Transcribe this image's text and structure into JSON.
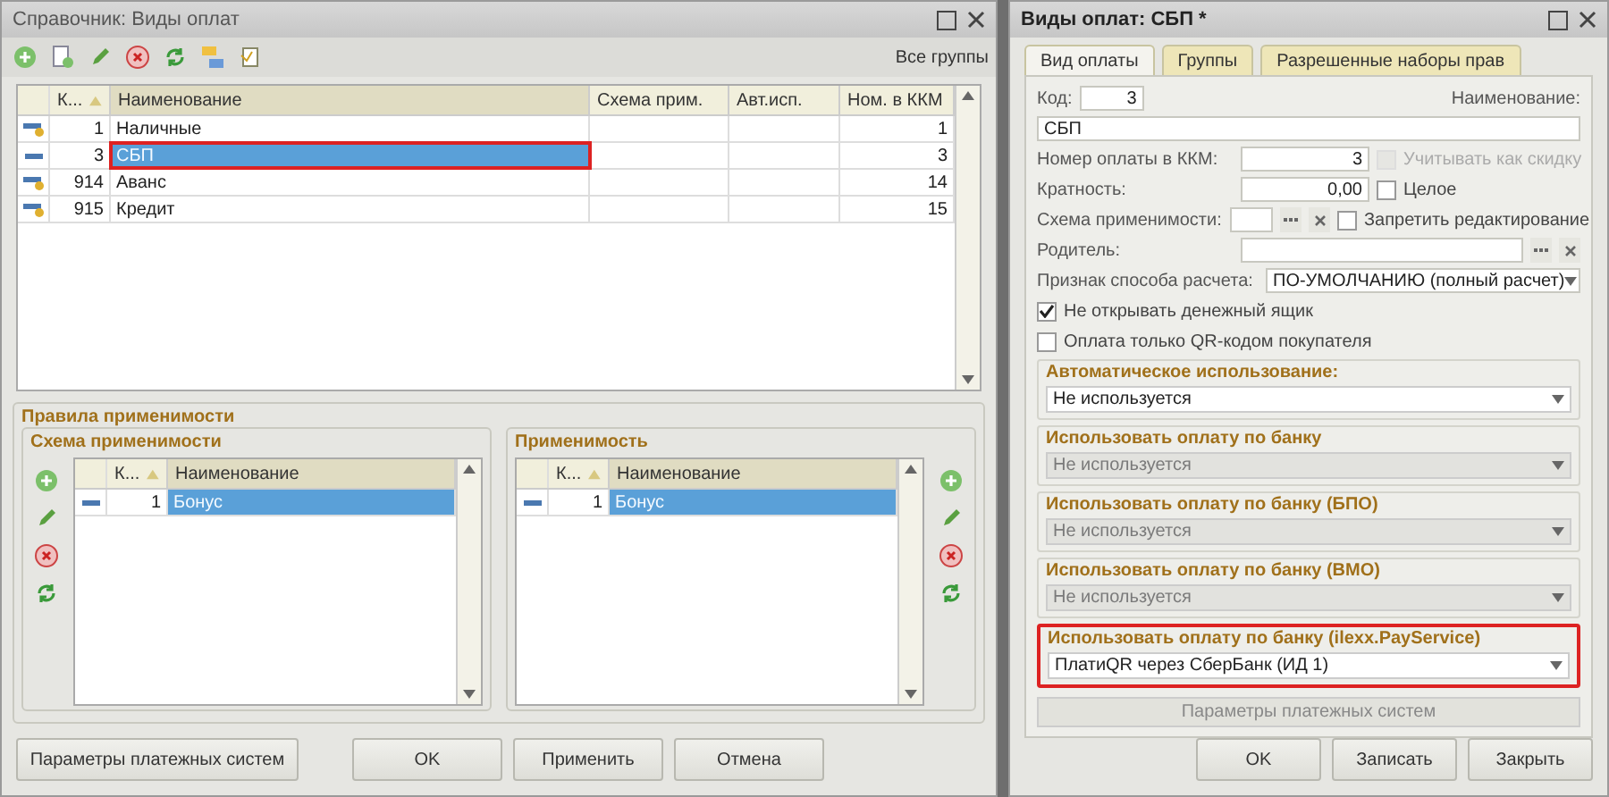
{
  "list_window": {
    "title": "Справочник: Виды оплат",
    "toolbar": {
      "groups_label": "Все группы"
    },
    "table": {
      "columns": [
        "К...",
        "Наименование",
        "Схема прим.",
        "Авт.исп.",
        "Ном. в ККМ"
      ],
      "rows": [
        {
          "kind": "marked",
          "code": "1",
          "name": "Наличные",
          "scheme": "",
          "auto": "",
          "kkm": "1",
          "selected": false,
          "highlighted": false
        },
        {
          "kind": "plain",
          "code": "3",
          "name": "СБП",
          "scheme": "",
          "auto": "",
          "kkm": "3",
          "selected": true,
          "highlighted": true
        },
        {
          "kind": "marked",
          "code": "914",
          "name": "Аванс",
          "scheme": "",
          "auto": "",
          "kkm": "14",
          "selected": false,
          "highlighted": false
        },
        {
          "kind": "marked",
          "code": "915",
          "name": "Кредит",
          "scheme": "",
          "auto": "",
          "kkm": "15",
          "selected": false,
          "highlighted": false
        }
      ]
    },
    "rules": {
      "title": "Правила применимости",
      "panels": [
        {
          "title": "Схема применимости",
          "columns": [
            "К...",
            "Наименование"
          ],
          "rows": [
            {
              "code": "1",
              "name": "Бонус",
              "selected": true
            }
          ]
        },
        {
          "title": "Применимость",
          "columns": [
            "К...",
            "Наименование"
          ],
          "rows": [
            {
              "code": "1",
              "name": "Бонус",
              "selected": true
            }
          ]
        }
      ]
    },
    "buttons": [
      "Параметры платежных систем",
      "OK",
      "Применить",
      "Отмена"
    ]
  },
  "form_window": {
    "title": "Виды оплат: СБП *",
    "tabs": [
      {
        "label": "Вид оплаты",
        "selected": true
      },
      {
        "label": "Группы",
        "selected": false
      },
      {
        "label": "Разрешенные наборы прав",
        "selected": false
      }
    ],
    "code_label": "Код:",
    "code": "3",
    "name_label": "Наименование:",
    "name": "СБП",
    "kkm_label": "Номер оплаты в ККМ:",
    "kkm": "3",
    "discount": {
      "label": "Учитывать как скидку",
      "checked": false,
      "disabled": true
    },
    "multiplicity_label": "Кратность:",
    "multiplicity": "0,00",
    "integer": {
      "label": "Целое",
      "checked": false,
      "disabled": false
    },
    "scheme_label": "Схема применимости:",
    "no_edit": {
      "label": "Запретить редактирование",
      "checked": false,
      "disabled": false
    },
    "parent_label": "Родитель:",
    "calc_label": "Признак способа расчета:",
    "calc": "ПО-УМОЛЧАНИЮ (полный расчет)",
    "checks": [
      {
        "label": "Не открывать денежный ящик",
        "checked": true
      },
      {
        "label": "Оплата только QR-кодом покупателя",
        "checked": false
      }
    ],
    "sections": [
      {
        "title": "Автоматическое использование:",
        "value": "Не используется",
        "disabled": false,
        "highlighted": false
      },
      {
        "title": "Использовать оплату по банку",
        "value": "Не используется",
        "disabled": true,
        "highlighted": false
      },
      {
        "title": "Использовать оплату по банку (БПО)",
        "value": "Не используется",
        "disabled": true,
        "highlighted": false
      },
      {
        "title": "Использовать оплату по банку (ВМО)",
        "value": "Не используется",
        "disabled": true,
        "highlighted": false
      },
      {
        "title": "Использовать оплату по банку (ilexx.PayService)",
        "value": "ПлатиQR через СберБанк (ИД 1)",
        "disabled": false,
        "highlighted": true
      }
    ],
    "params_button": {
      "label": "Параметры платежных систем",
      "disabled": true
    },
    "buttons": [
      "OK",
      "Записать",
      "Закрыть"
    ]
  }
}
